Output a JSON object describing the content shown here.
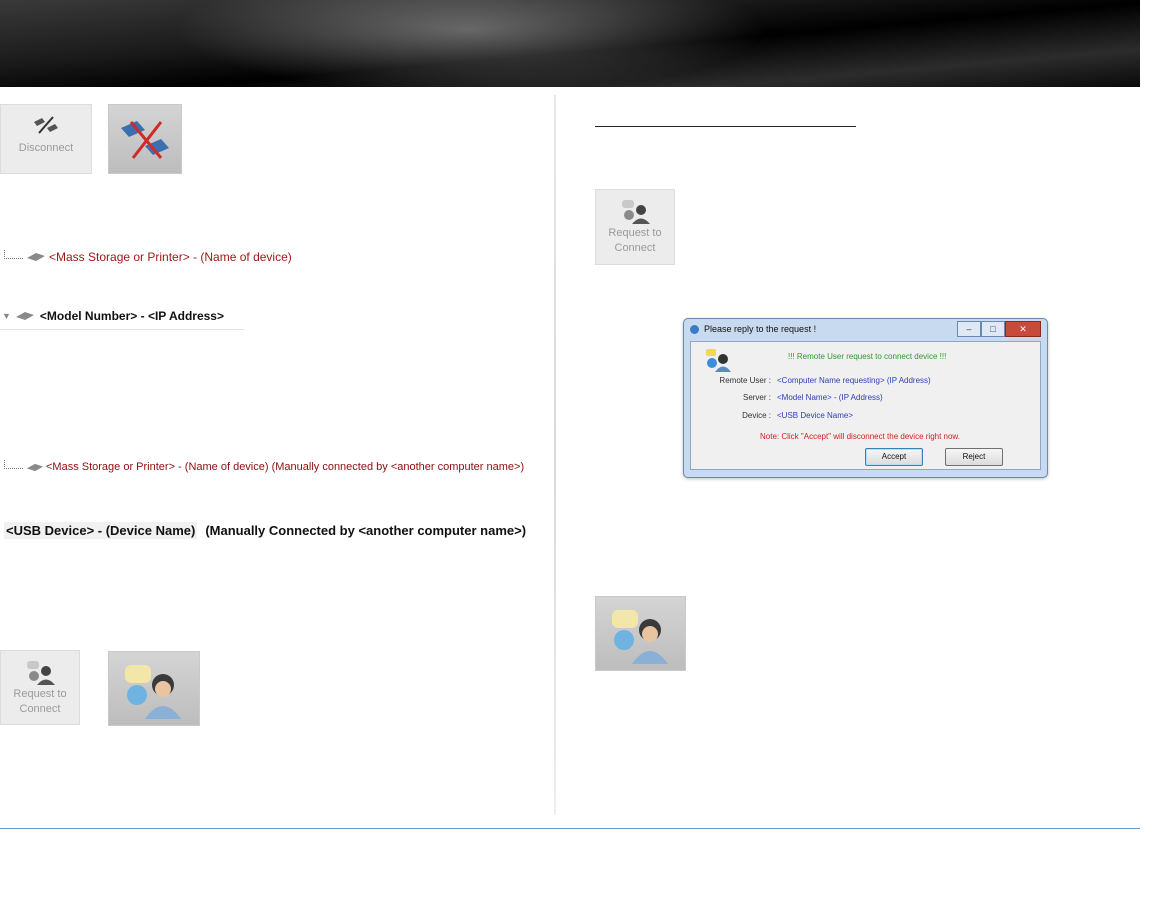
{
  "left": {
    "disconnect_tile": {
      "label": "Disconnect",
      "icon": "disconnect-icon"
    },
    "disconnect_big_icon": "disconnect-large-icon",
    "tree1": {
      "text": "<Mass Storage or Printer> - (Name of device)"
    },
    "tree2": {
      "text": "<Model Number> - <IP Address>"
    },
    "tree3": {
      "text": "<Mass Storage or Printer> - (Name of device)  (Manually connected by  <another computer name>)"
    },
    "tree4": {
      "part1": "<USB Device> - (Device Name)",
      "part2": "(Manually Connected by <another computer name>)"
    },
    "request_tile": {
      "label_line1": "Request to",
      "label_line2": "Connect",
      "icon": "request-connect-icon"
    },
    "request_big_icon": "request-connect-large-icon"
  },
  "right": {
    "request_tile": {
      "label_line1": "Request to",
      "label_line2": "Connect",
      "icon": "request-connect-icon"
    },
    "dialog": {
      "title": "Please reply to the request !",
      "message": "!!! Remote User request to connect device !!!",
      "rows": [
        {
          "label": "Remote User :",
          "value": "<Computer Name requesting> (IP Address)"
        },
        {
          "label": "Server :",
          "value": "<Model Name> - (IP Address)"
        },
        {
          "label": "Device :",
          "value": "<USB Device Name>"
        }
      ],
      "note": "Note: Click \"Accept\" will disconnect the device right now.",
      "accept": "Accept",
      "reject": "Reject"
    },
    "request_big_icon": "request-connect-large-icon"
  },
  "colors": {
    "link_blue": "#2a3fb8",
    "dark_red": "#a01818",
    "footer_rule": "#6a9ac9"
  }
}
